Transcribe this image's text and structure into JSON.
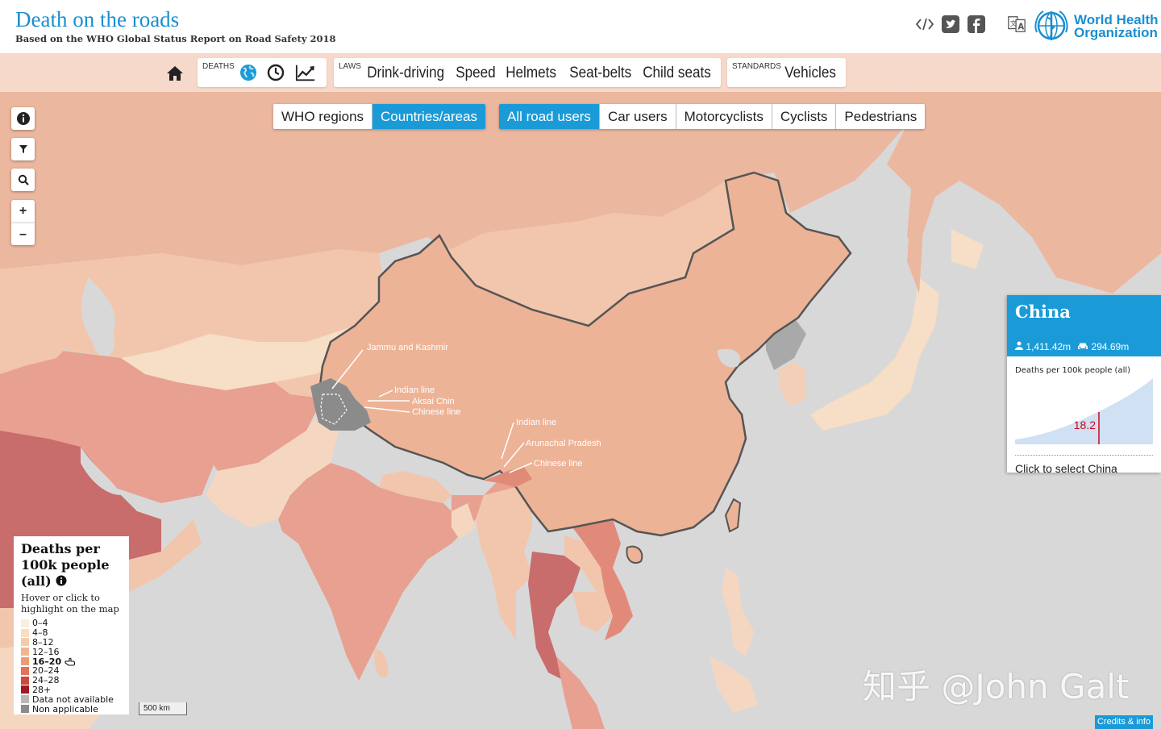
{
  "header": {
    "title": "Death on the roads",
    "subtitle": "Based on the WHO Global Status Report on Road Safety 2018",
    "who_line1": "World Health",
    "who_line2": "Organization",
    "icons": [
      "embed-icon",
      "twitter-icon",
      "facebook-icon",
      "translate-icon"
    ]
  },
  "nav": {
    "deaths_caption": "DEATHS",
    "laws_caption": "LAWS",
    "laws_items": [
      "Drink-driving",
      "Speed",
      "Helmets",
      "Seat-belts",
      "Child seats"
    ],
    "standards_caption": "STANDARDS",
    "standards_items": [
      "Vehicles"
    ]
  },
  "toggles": {
    "regions": [
      {
        "label": "WHO regions",
        "active": false
      },
      {
        "label": "Countries/areas",
        "active": true
      }
    ],
    "users": [
      {
        "label": "All road users",
        "active": true
      },
      {
        "label": "Car users",
        "active": false
      },
      {
        "label": "Motorcyclists",
        "active": false
      },
      {
        "label": "Cyclists",
        "active": false
      },
      {
        "label": "Pedestrians",
        "active": false
      }
    ]
  },
  "controls": {
    "zoom_in": "+",
    "zoom_out": "–"
  },
  "map_labels": {
    "jammu": "Jammu and Kashmir",
    "indian_line_1": "Indian line",
    "aksai": "Aksai Chin",
    "chinese_line_1": "Chinese line",
    "indian_line_2": "Indian line",
    "arunachal": "Arunachal Pradesh",
    "chinese_line_2": "Chinese line"
  },
  "legend": {
    "title": "Deaths per 100k people (all)",
    "subtitle": "Hover or click to highlight on the map",
    "items": [
      {
        "label": "0–4",
        "color": "#fbeede",
        "bold": false
      },
      {
        "label": "4–8",
        "color": "#f8dfc3",
        "bold": false
      },
      {
        "label": "8–12",
        "color": "#f5ccaa",
        "bold": false
      },
      {
        "label": "12–16",
        "color": "#f1b58f",
        "bold": false
      },
      {
        "label": "16–20",
        "color": "#ec9c75",
        "bold": true
      },
      {
        "label": "20–24",
        "color": "#e2735c",
        "bold": false
      },
      {
        "label": "24–28",
        "color": "#c94a40",
        "bold": false
      },
      {
        "label": "28+",
        "color": "#9e1a1f",
        "bold": false
      },
      {
        "label": "Data not available",
        "color": "#b8b8b8",
        "bold": false
      },
      {
        "label": "Non applicable",
        "color": "#8b8b8b",
        "bold": false
      }
    ]
  },
  "scale": "500 km",
  "info": {
    "country": "China",
    "population": "1,411.42m",
    "vehicles": "294.69m",
    "metric_label": "Deaths per 100k people (all)",
    "value": 18.2,
    "value_label": "18.2",
    "click_text": "Click to select China"
  },
  "credits": "Credits & info",
  "watermark": "知乎 @John Galt",
  "colors": {
    "accent": "#1a9bd8",
    "title": "#1a8fd0",
    "navbar": "#f7d9cb"
  }
}
